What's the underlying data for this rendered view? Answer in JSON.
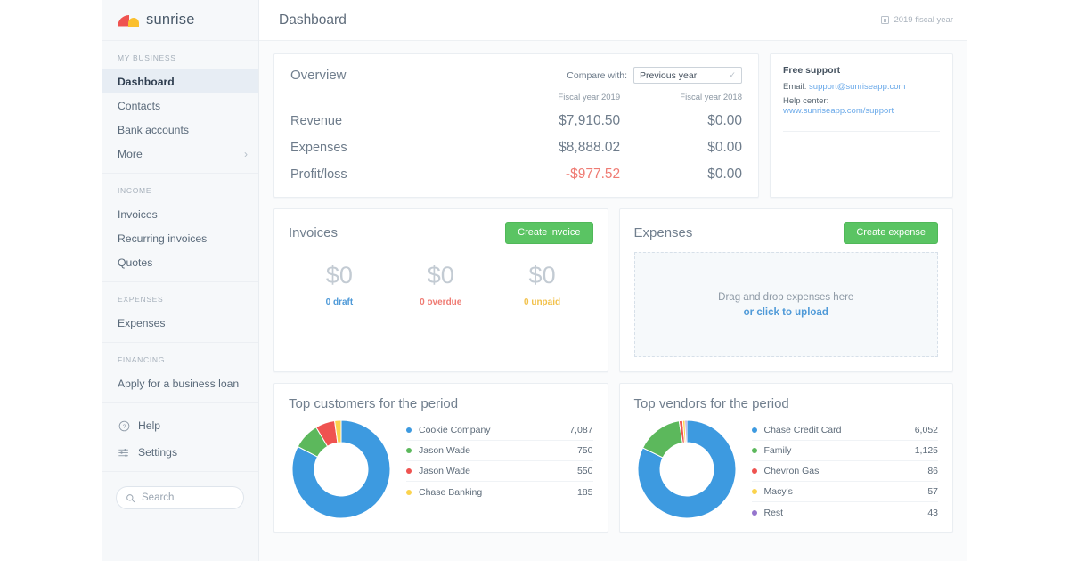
{
  "brand": {
    "name": "sunrise",
    "logo_icon": "sunrise-logo-icon",
    "colors": {
      "red": "#ef5350",
      "yellow": "#fbc02d"
    }
  },
  "sidebar": {
    "groups": [
      {
        "label": "MY BUSINESS",
        "items": [
          {
            "label": "Dashboard",
            "active": true
          },
          {
            "label": "Contacts",
            "active": false
          },
          {
            "label": "Bank accounts",
            "active": false
          },
          {
            "label": "More",
            "active": false,
            "chevron": "›"
          }
        ]
      },
      {
        "label": "INCOME",
        "items": [
          {
            "label": "Invoices"
          },
          {
            "label": "Recurring invoices"
          },
          {
            "label": "Quotes"
          }
        ]
      },
      {
        "label": "EXPENSES",
        "items": [
          {
            "label": "Expenses"
          }
        ]
      },
      {
        "label": "FINANCING",
        "items": [
          {
            "label": "Apply for a business loan"
          }
        ]
      }
    ],
    "utility": [
      {
        "label": "Help",
        "icon": "help-circle-icon"
      },
      {
        "label": "Settings",
        "icon": "sliders-icon"
      }
    ],
    "search": {
      "placeholder": "Search",
      "icon": "search-icon"
    }
  },
  "header": {
    "title": "Dashboard",
    "fiscal_year": "2019 fiscal year",
    "fiscal_icon": "calendar-icon"
  },
  "overview": {
    "title": "Overview",
    "compare_label": "Compare with:",
    "compare_value": "Previous year",
    "compare_options": [
      "Previous year"
    ],
    "columns": [
      "",
      "Fiscal year 2019",
      "Fiscal year 2018"
    ],
    "rows": [
      {
        "label": "Revenue",
        "current": "$7,910.50",
        "previous": "$0.00",
        "negative": false
      },
      {
        "label": "Expenses",
        "current": "$8,888.02",
        "previous": "$0.00",
        "negative": false
      },
      {
        "label": "Profit/loss",
        "current": "-$977.52",
        "previous": "$0.00",
        "negative": true
      }
    ]
  },
  "support": {
    "title": "Free support",
    "email_label": "Email:",
    "email_value": "support@sunriseapp.com",
    "help_label": "Help center:",
    "help_value": "www.sunriseapp.com/support"
  },
  "invoices": {
    "title": "Invoices",
    "button": "Create invoice",
    "stats": [
      {
        "amount": "$0",
        "label": "0 draft",
        "color": "#4f9ad8"
      },
      {
        "amount": "$0",
        "label": "0 overdue",
        "color": "#ef7b73"
      },
      {
        "amount": "$0",
        "label": "0 unpaid",
        "color": "#f2c14b"
      }
    ]
  },
  "expenses": {
    "title": "Expenses",
    "button": "Create expense",
    "dropzone_line1": "Drag and drop expenses here",
    "dropzone_line2": "or click to upload"
  },
  "chart_data": [
    {
      "type": "pie",
      "title": "Top customers for the period",
      "categories": [
        "Cookie Company",
        "Jason Wade",
        "Jason Wade",
        "Chase Banking"
      ],
      "values": [
        7087,
        750,
        550,
        185
      ],
      "labels": [
        "7,087",
        "750",
        "550",
        "185"
      ],
      "colors": [
        "#3d9ae0",
        "#5cb85c",
        "#ef5350",
        "#fbd34d"
      ],
      "legend": "right",
      "donut": true
    },
    {
      "type": "pie",
      "title": "Top vendors for the period",
      "categories": [
        "Chase Credit Card",
        "Family",
        "Chevron Gas",
        "Macy's",
        "Rest"
      ],
      "values": [
        6052,
        1125,
        86,
        57,
        43
      ],
      "labels": [
        "6,052",
        "1,125",
        "86",
        "57",
        "43"
      ],
      "colors": [
        "#3d9ae0",
        "#5cb85c",
        "#ef5350",
        "#fbd34d",
        "#9575cd"
      ],
      "legend": "right",
      "donut": true
    }
  ]
}
